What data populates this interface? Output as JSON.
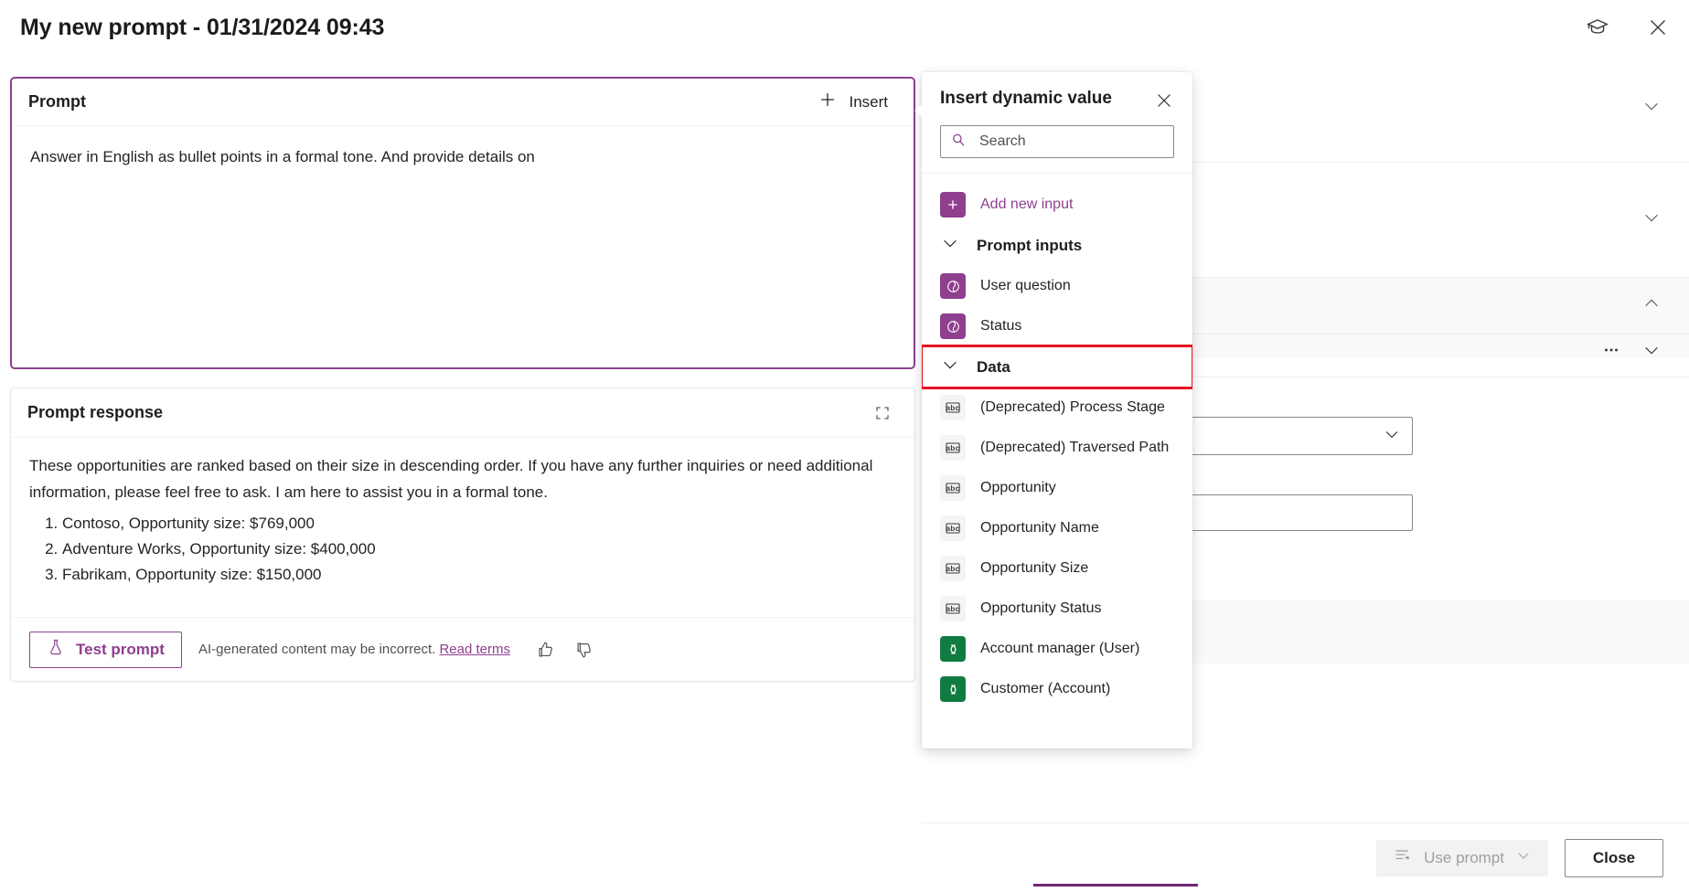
{
  "titlebar": {
    "title": "My new prompt - 01/31/2024 09:43",
    "learn_icon": "graduation-cap-icon",
    "close_icon": "close-icon"
  },
  "prompt_card": {
    "heading": "Prompt",
    "insert_label": "Insert",
    "insert_icon": "plus-icon",
    "text": "Answer in English as bullet points in a formal tone. And provide details on"
  },
  "response_card": {
    "heading": "Prompt response",
    "expand_icon": "fullscreen-icon",
    "paragraph": "These opportunities are ranked based on their size in descending order. If you have any further inquiries or need additional information, please feel free to ask. I am here to assist you in a formal tone.",
    "list": [
      "Contoso, Opportunity size: $769,000",
      "Adventure Works, Opportunity size: $400,000",
      "Fabrikam, Opportunity size: $150,000"
    ],
    "test_button": "Test prompt",
    "test_icon": "flask-icon",
    "disclaimer": "AI-generated content may be incorrect.",
    "disclaimer_link": "Read terms",
    "thumbs_up_icon": "thumbs-up-icon",
    "thumbs_down_icon": "thumbs-down-icon"
  },
  "flyout": {
    "title": "Insert dynamic value",
    "close_icon": "close-icon",
    "search": {
      "placeholder": "Search",
      "value": "",
      "icon": "search-icon"
    },
    "add_new_input": {
      "label": "Add new input",
      "icon": "plus-icon"
    },
    "groups": [
      {
        "label": "Prompt inputs",
        "chevron": "chevron-down-icon",
        "highlighted": false,
        "items": [
          {
            "label": "User question",
            "icon": "copilot-icon",
            "icon_style": "purple"
          },
          {
            "label": "Status",
            "icon": "copilot-icon",
            "icon_style": "purple"
          }
        ]
      },
      {
        "label": "Data",
        "chevron": "chevron-down-icon",
        "highlighted": true,
        "items": [
          {
            "label": "(Deprecated) Process Stage",
            "icon": "text-field-icon",
            "icon_style": "grey"
          },
          {
            "label": "(Deprecated) Traversed Path",
            "icon": "text-field-icon",
            "icon_style": "grey"
          },
          {
            "label": "Opportunity",
            "icon": "text-field-icon",
            "icon_style": "grey"
          },
          {
            "label": "Opportunity Name",
            "icon": "text-field-icon",
            "icon_style": "grey"
          },
          {
            "label": "Opportunity Size",
            "icon": "text-field-icon",
            "icon_style": "grey"
          },
          {
            "label": "Opportunity Status",
            "icon": "text-field-icon",
            "icon_style": "grey"
          },
          {
            "label": "Account manager (User)",
            "icon": "table-icon",
            "icon_style": "green"
          },
          {
            "label": "Customer (Account)",
            "icon": "table-icon",
            "icon_style": "green"
          }
        ]
      }
    ]
  },
  "action_bar": {
    "use_prompt_label": "Use prompt",
    "use_prompt_icon": "insert-text-icon",
    "use_prompt_chevron": "chevron-down-icon",
    "close_label": "Close"
  },
  "colors": {
    "accent_purple": "#8e3f8e",
    "brand_purple": "#742774",
    "green": "#107c41",
    "highlight_red": "#e81123"
  }
}
